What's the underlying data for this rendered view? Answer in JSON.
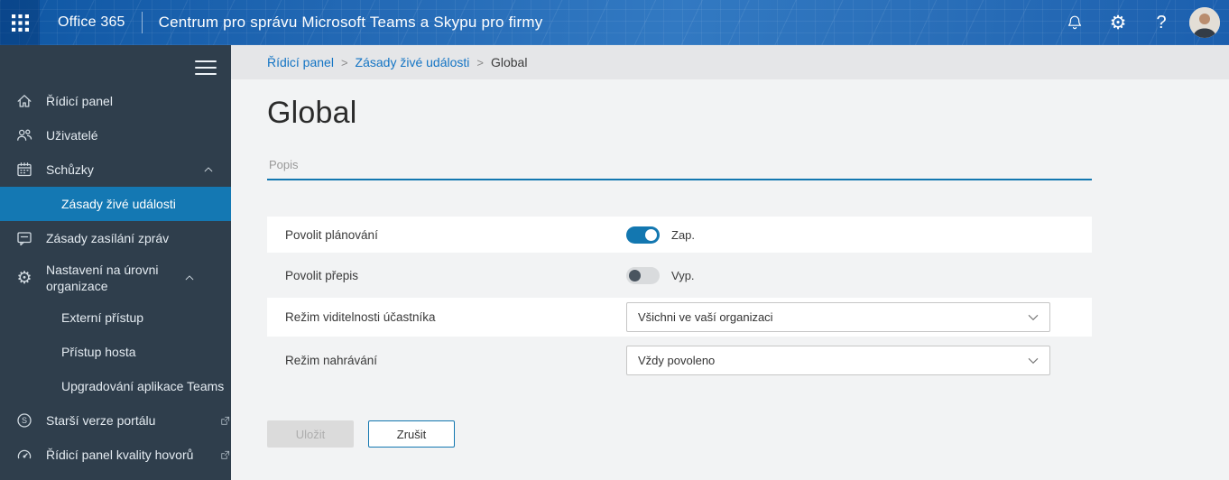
{
  "topbar": {
    "brand": "Office 365",
    "title": "Centrum pro správu Microsoft Teams a Skypu pro firmy",
    "gear_glyph": "⚙",
    "help_glyph": "?"
  },
  "sidebar": {
    "skype_s": "S",
    "items": [
      {
        "label": "Řídicí panel",
        "icon": "home-icon"
      },
      {
        "label": "Uživatelé",
        "icon": "people-icon"
      },
      {
        "label": "Schůzky",
        "icon": "calendar-icon",
        "expanded": true
      },
      {
        "label": "Zásady živé události",
        "sub": true,
        "active": true
      },
      {
        "label": "Zásady zasílání zpráv",
        "icon": "chat-icon"
      },
      {
        "label": "Nastavení na úrovni organizace",
        "icon": "gear-icon",
        "expanded": true
      },
      {
        "label": "Externí přístup",
        "sub": true
      },
      {
        "label": "Přístup hosta",
        "sub": true
      },
      {
        "label": "Upgradování aplikace Teams",
        "sub": true
      },
      {
        "label": "Starší verze portálu",
        "icon": "skype-icon",
        "external": true
      },
      {
        "label": "Řídicí panel kvality hovorů",
        "icon": "gauge-icon",
        "external": true
      }
    ]
  },
  "breadcrumb": {
    "items": [
      "Řídicí panel",
      "Zásady živé události",
      "Global"
    ],
    "separator": ">"
  },
  "main": {
    "title": "Global",
    "description_placeholder": "Popis",
    "settings": [
      {
        "label": "Povolit plánování",
        "type": "toggle",
        "state": "on",
        "state_label": "Zap."
      },
      {
        "label": "Povolit přepis",
        "type": "toggle",
        "state": "off",
        "state_label": "Vyp."
      },
      {
        "label": "Režim viditelnosti účastníka",
        "type": "dropdown",
        "value": "Všichni ve vaší organizaci"
      },
      {
        "label": "Režim nahrávání",
        "type": "dropdown",
        "value": "Vždy povoleno"
      }
    ],
    "buttons": {
      "save": "Uložit",
      "cancel": "Zrušit"
    }
  },
  "colors": {
    "accent": "#1377b0",
    "link": "#1374c4",
    "topbar_blue": "#2268b4",
    "sidebar_bg": "#2f3e4c",
    "sidebar_active": "#1478b3",
    "page_bg": "#f2f3f4",
    "breadcrumb_bg": "#e5e6e8",
    "toggle_off_track": "#d9dbdd",
    "toggle_off_knob": "#4a5560",
    "disabled_bg": "#dbdbdb",
    "disabled_text": "#aeaeae",
    "text": "#333333",
    "muted": "#999999"
  }
}
